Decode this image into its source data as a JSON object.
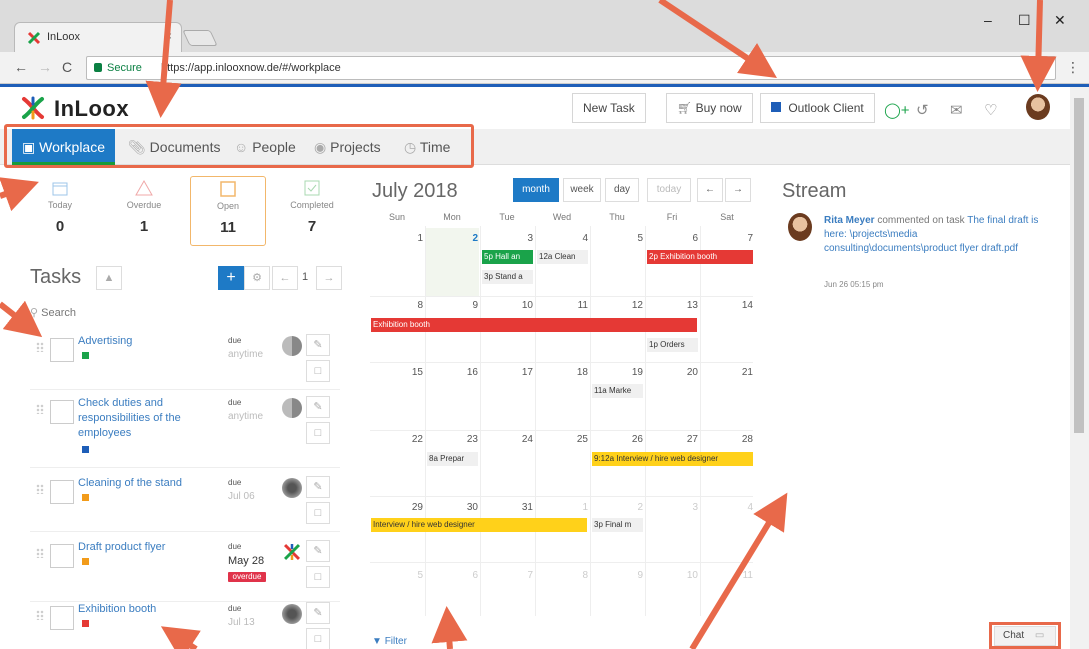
{
  "browser": {
    "tab_title": "InLoox",
    "tab_close": "×",
    "secure_label": "Secure",
    "url": "https://app.inlooxnow.de/#/workplace",
    "window_controls": {
      "minimize": "–",
      "maximize": "☐",
      "close": "✕"
    },
    "nav": {
      "back": "←",
      "forward": "→",
      "reload": "C",
      "menu": "⋮"
    }
  },
  "header": {
    "logo": "InLoox",
    "buttons": {
      "new_task": "New Task",
      "buy_now": "Buy now",
      "outlook_client": "Outlook Client"
    },
    "icons": [
      "add-user-icon",
      "history-icon",
      "mail-icon",
      "bell-icon"
    ]
  },
  "nav_tabs": [
    {
      "label": "Workplace",
      "icon": "monitor-icon",
      "active": true
    },
    {
      "label": "Documents",
      "icon": "paperclip-icon"
    },
    {
      "label": "People",
      "icon": "person-icon"
    },
    {
      "label": "Projects",
      "icon": "projects-icon"
    },
    {
      "label": "Time",
      "icon": "clock-icon"
    }
  ],
  "stats": [
    {
      "label": "Today",
      "value": "0",
      "icon": "calendar-icon"
    },
    {
      "label": "Overdue",
      "value": "1",
      "icon": "warning-icon"
    },
    {
      "label": "Open",
      "value": "11",
      "icon": "square-icon"
    },
    {
      "label": "Completed",
      "value": "7",
      "icon": "checkmark-icon"
    }
  ],
  "tasks_panel": {
    "title": "Tasks",
    "page": "1",
    "search_placeholder": "Search",
    "buttons": {
      "add": "+",
      "prev": "←",
      "next": "→"
    }
  },
  "tasks": [
    {
      "title": "Advertising",
      "due_label": "due",
      "due_value": "anytime",
      "color": "#1aa34a"
    },
    {
      "title": "Check duties and responsibilities of the employees",
      "due_label": "due",
      "due_value": "anytime",
      "color": "#1e5eb8"
    },
    {
      "title": "Cleaning of the stand",
      "due_label": "due",
      "due_value": "Jul 06",
      "color": "#f29b1a"
    },
    {
      "title": "Draft product flyer",
      "due_label": "due",
      "due_value": "May 28",
      "badge": "overdue",
      "color": "#f29b1a"
    },
    {
      "title": "Exhibition booth",
      "due_label": "due",
      "due_value": "Jul 13",
      "color": "#e53935"
    }
  ],
  "calendar": {
    "title": "July 2018",
    "views": [
      "month",
      "week",
      "day"
    ],
    "today_label": "today",
    "prev": "←",
    "next": "→",
    "weekdays": [
      "Sun",
      "Mon",
      "Tue",
      "Wed",
      "Thu",
      "Fri",
      "Sat"
    ],
    "weeks": [
      [
        "1",
        "2",
        "3",
        "4",
        "5",
        "6",
        "7"
      ],
      [
        "8",
        "9",
        "10",
        "11",
        "12",
        "13",
        "14"
      ],
      [
        "15",
        "16",
        "17",
        "18",
        "19",
        "20",
        "21"
      ],
      [
        "22",
        "23",
        "24",
        "25",
        "26",
        "27",
        "28"
      ],
      [
        "29",
        "30",
        "31",
        "1",
        "2",
        "3",
        "4"
      ],
      [
        "5",
        "6",
        "7",
        "8",
        "9",
        "10",
        "11"
      ]
    ],
    "events": {
      "hall": "5p Hall an",
      "stand": "3p Stand a",
      "clean": "12a Clean",
      "booth_single": "2p Exhibition booth",
      "booth_span": "Exhibition booth",
      "orders": "1p Orders",
      "market": "11a Marke",
      "prepare": "8a Prepar",
      "interview": "9:12a Interview / hire web designer",
      "interview_cont": "Interview / hire web designer",
      "final": "3p Final m"
    },
    "filter": "Filter"
  },
  "stream": {
    "title": "Stream",
    "author": "Rita Meyer",
    "action": "commented on task",
    "task_link": "The final draft is here: \\projects\\media consulting\\documents\\product flyer draft.pdf",
    "time": "Jun 26 05:15 pm"
  },
  "chat": {
    "label": "Chat"
  },
  "colors": {
    "brand_blue": "#1e7ac6",
    "annotation": "#e8694a",
    "event_red": "#e53935",
    "event_green": "#1aa34a",
    "event_yellow": "#ffd11a"
  }
}
